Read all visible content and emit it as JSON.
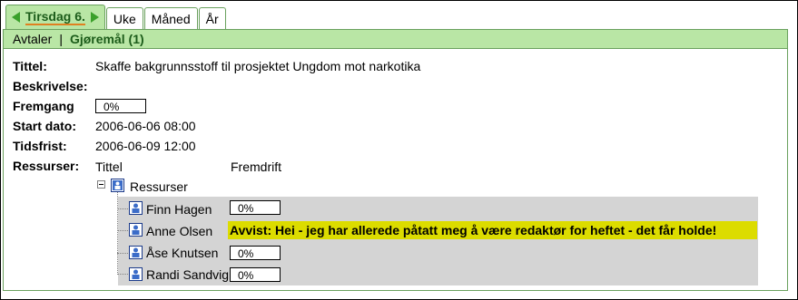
{
  "tabs": {
    "active_label": "Tirsdag 6.",
    "week": "Uke",
    "month": "Måned",
    "year": "År"
  },
  "subnav": {
    "appointments": "Avtaler",
    "separator": "|",
    "tasks": "Gjøremål (1)"
  },
  "task": {
    "title_label": "Tittel:",
    "title_value": "Skaffe bakgrunnsstoff til prosjektet Ungdom mot narkotika",
    "description_label": "Beskrivelse:",
    "progress_label": "Fremgang",
    "progress_value": "0%",
    "start_label": "Start dato:",
    "start_value": "2006-06-06 08:00",
    "deadline_label": "Tidsfrist:",
    "deadline_value": "2006-06-09 12:00",
    "resources_label": "Ressurser:",
    "col_title": "Tittel",
    "col_progress": "Fremdrift"
  },
  "tree": {
    "root_label": "Ressurser",
    "items": [
      {
        "name": "Finn Hagen",
        "progress": "0%"
      },
      {
        "name": "Anne Olsen",
        "status": "Avvist: Hei - jeg har allerede påtatt meg å være redaktør for heftet - det får holde!"
      },
      {
        "name": "Åse Knutsen",
        "progress": "0%"
      },
      {
        "name": "Randi Sandvig",
        "progress": "0%"
      }
    ]
  },
  "colors": {
    "tab_green": "#b9e6a5",
    "border_green": "#6aa15e",
    "arrow_green": "#3aa02a",
    "rejected_yellow": "#dcdc00",
    "row_grey": "#d4d4d4"
  }
}
